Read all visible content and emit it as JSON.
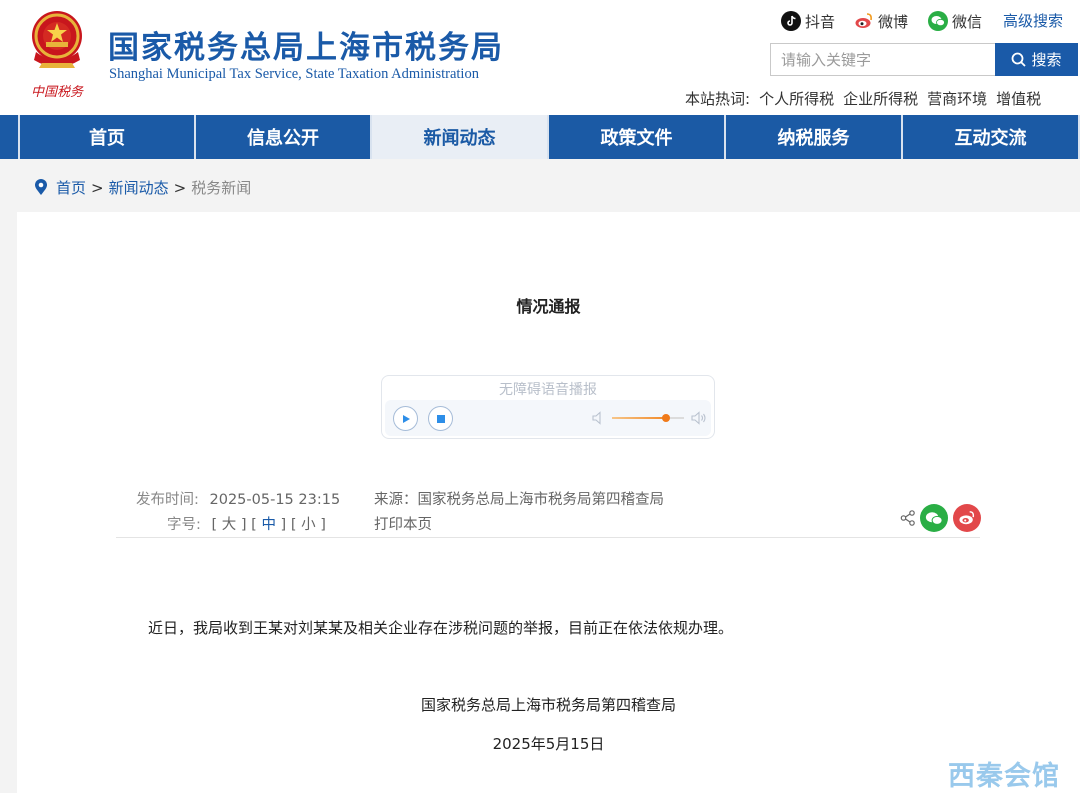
{
  "header": {
    "emblem_caption": "中国税务",
    "title": "国家税务总局上海市税务局",
    "subtitle": "Shanghai Municipal Tax Service, State Taxation Administration",
    "social": [
      {
        "label": "抖音",
        "icon": "douyin-icon"
      },
      {
        "label": "微博",
        "icon": "weibo-icon"
      },
      {
        "label": "微信",
        "icon": "wechat-icon"
      }
    ],
    "advanced_search": "高级搜索",
    "search": {
      "placeholder": "请输入关键字",
      "value": "",
      "button": "搜索"
    },
    "hot_label": "本站热词:",
    "hot_words": [
      "个人所得税",
      "企业所得税",
      "营商环境",
      "增值税"
    ]
  },
  "nav": {
    "items": [
      {
        "label": "首页",
        "active": false
      },
      {
        "label": "信息公开",
        "active": false
      },
      {
        "label": "新闻动态",
        "active": true
      },
      {
        "label": "政策文件",
        "active": false
      },
      {
        "label": "纳税服务",
        "active": false
      },
      {
        "label": "互动交流",
        "active": false
      }
    ]
  },
  "breadcrumb": [
    "首页",
    "新闻动态",
    "税务新闻"
  ],
  "article": {
    "title": "情况通报",
    "player_label": "无障碍语音播报",
    "volume_level": 0.75,
    "publish_label": "发布时间:",
    "publish_time": "2025-05-15 23:15",
    "source": "来源：国家税务总局上海市税务局第四稽查局",
    "font_label": "字号:",
    "font_large": "大",
    "font_medium": "中",
    "font_small": "小",
    "print": "打印本页",
    "body": "近日，我局收到王某对刘某某及相关企业存在涉税问题的举报，目前正在依法依规办理。",
    "signer": "国家税务总局上海市税务局第四稽查局",
    "date": "2025年5月15日"
  },
  "watermark": "西秦会馆",
  "colors": {
    "brand": "#1a5aa8",
    "nav_bg": "#1b5aa5",
    "nav_active_bg": "#e9eef5",
    "wechat_green": "#2aae45",
    "weibo_red": "#e2484a",
    "emblem_red": "#c8161d",
    "emblem_gold": "#e8b33a"
  }
}
